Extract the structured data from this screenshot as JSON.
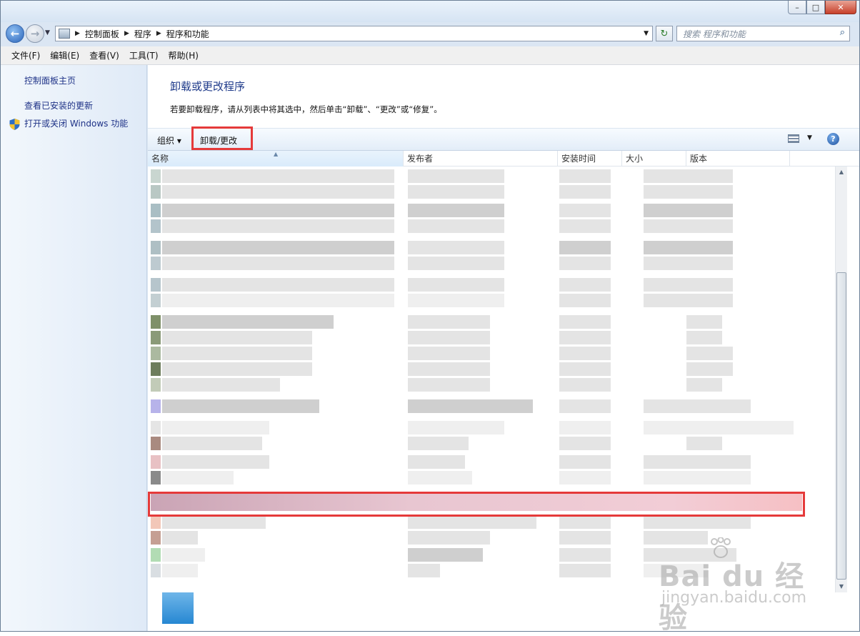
{
  "window": {
    "captions": {
      "minimize": "–",
      "maximize": "□",
      "close": "✕"
    }
  },
  "navigation": {
    "back_glyph": "←",
    "forward_glyph": "→",
    "breadcrumbs": [
      "控制面板",
      "程序",
      "程序和功能"
    ],
    "refresh_glyph": "↻",
    "search_placeholder": "搜索 程序和功能",
    "search_glyph": "⌕"
  },
  "menu": [
    "文件(F)",
    "编辑(E)",
    "查看(V)",
    "工具(T)",
    "帮助(H)"
  ],
  "sidebar": {
    "home": "控制面板主页",
    "view_updates": "查看已安装的更新",
    "windows_features": "打开或关闭 Windows 功能"
  },
  "main": {
    "heading": "卸载或更改程序",
    "description": "若要卸载程序，请从列表中将其选中，然后单击“卸载”、“更改”或“修复”。"
  },
  "toolbar": {
    "organize": "组织 ▾",
    "uninstall_change": "卸载/更改",
    "help": "?"
  },
  "columns": [
    "名称",
    "发布者",
    "安装时间",
    "大小",
    "版本"
  ],
  "watermark": {
    "brand": "Bai du 经验",
    "sub": "jingyan.baidu.com"
  },
  "colors": {
    "highlight": "#e53a3a",
    "link": "#1e3287",
    "heading": "#1e3a8a",
    "selected_row": "#f2cdd6"
  }
}
